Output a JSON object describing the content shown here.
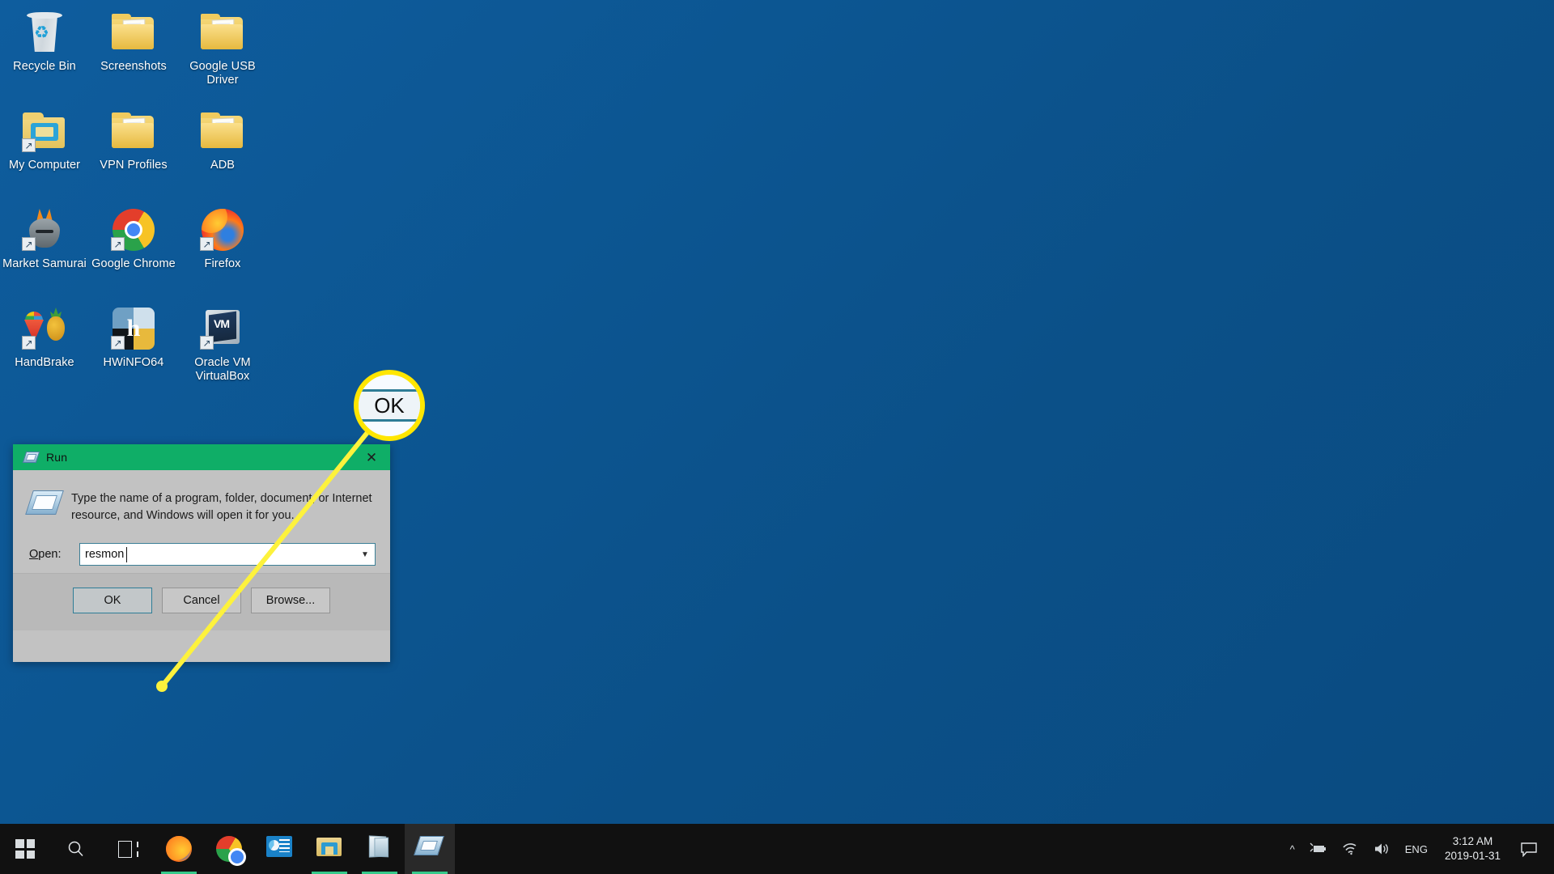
{
  "desktop": {
    "background_color": "#0b5088",
    "icons": [
      {
        "label": "Recycle Bin",
        "icon": "recycle-bin-icon",
        "shortcut": false
      },
      {
        "label": "Screenshots",
        "icon": "folder-icon",
        "shortcut": false
      },
      {
        "label": "Google USB Driver",
        "icon": "folder-icon",
        "shortcut": false
      },
      {
        "label": "My Computer",
        "icon": "my-computer-icon",
        "shortcut": true
      },
      {
        "label": "VPN Profiles",
        "icon": "folder-icon",
        "shortcut": false
      },
      {
        "label": "ADB",
        "icon": "folder-icon",
        "shortcut": false
      },
      {
        "label": "Market Samurai",
        "icon": "market-samurai-icon",
        "shortcut": true
      },
      {
        "label": "Google Chrome",
        "icon": "chrome-icon",
        "shortcut": true
      },
      {
        "label": "Firefox",
        "icon": "firefox-icon",
        "shortcut": true
      },
      {
        "label": "HandBrake",
        "icon": "handbrake-icon",
        "shortcut": true
      },
      {
        "label": "HWiNFO64",
        "icon": "hwinfo64-icon",
        "shortcut": true
      },
      {
        "label": "Oracle VM VirtualBox",
        "icon": "virtualbox-icon",
        "shortcut": true
      }
    ]
  },
  "run_dialog": {
    "title": "Run",
    "title_icon": "run-icon",
    "titlebar_color": "#0fae67",
    "close_label": "✕",
    "description": "Type the name of a program, folder, document, or Internet resource, and Windows will open it for you.",
    "open_label_prefix": "O",
    "open_label_rest": "pen:",
    "open_value": "resmon",
    "open_placeholder": "",
    "dropdown_arrow": "⌄",
    "buttons": [
      {
        "label": "OK",
        "name": "ok-button",
        "default": true
      },
      {
        "label": "Cancel",
        "name": "cancel-button",
        "default": false
      },
      {
        "label": "Browse...",
        "name": "browse-button",
        "default": false,
        "underline_char": "B"
      }
    ]
  },
  "callout": {
    "label": "OK",
    "ring_color": "#ffe600",
    "line_color": "#fdf23c",
    "button_border_color": "#2e7d96"
  },
  "taskbar": {
    "background_color": "#111111",
    "start_label": "start-button",
    "items": [
      {
        "name": "start-button",
        "icon": "windows-logo-icon"
      },
      {
        "name": "search-button",
        "icon": "search-icon"
      },
      {
        "name": "task-view-button",
        "icon": "task-view-icon"
      },
      {
        "name": "taskbar-firefox",
        "icon": "firefox-icon",
        "active": false,
        "running": true
      },
      {
        "name": "taskbar-chrome",
        "icon": "chrome-icon",
        "active": false,
        "running": false
      },
      {
        "name": "taskbar-paint",
        "icon": "paint-icon",
        "active": false,
        "running": false
      },
      {
        "name": "taskbar-file-explorer",
        "icon": "folder-icon",
        "active": false,
        "running": true
      },
      {
        "name": "taskbar-notepad",
        "icon": "notepad-icon",
        "active": false,
        "running": true
      },
      {
        "name": "taskbar-run",
        "icon": "run-icon",
        "active": true,
        "running": true
      }
    ],
    "tray": {
      "overflow_icon": "chevron-up-icon",
      "battery_icon": "battery-charging-icon",
      "network_icon": "wifi-icon",
      "volume_icon": "speaker-icon",
      "language": "ENG",
      "time": "3:12 AM",
      "date": "2019-01-31",
      "action_center_icon": "action-center-icon"
    }
  }
}
